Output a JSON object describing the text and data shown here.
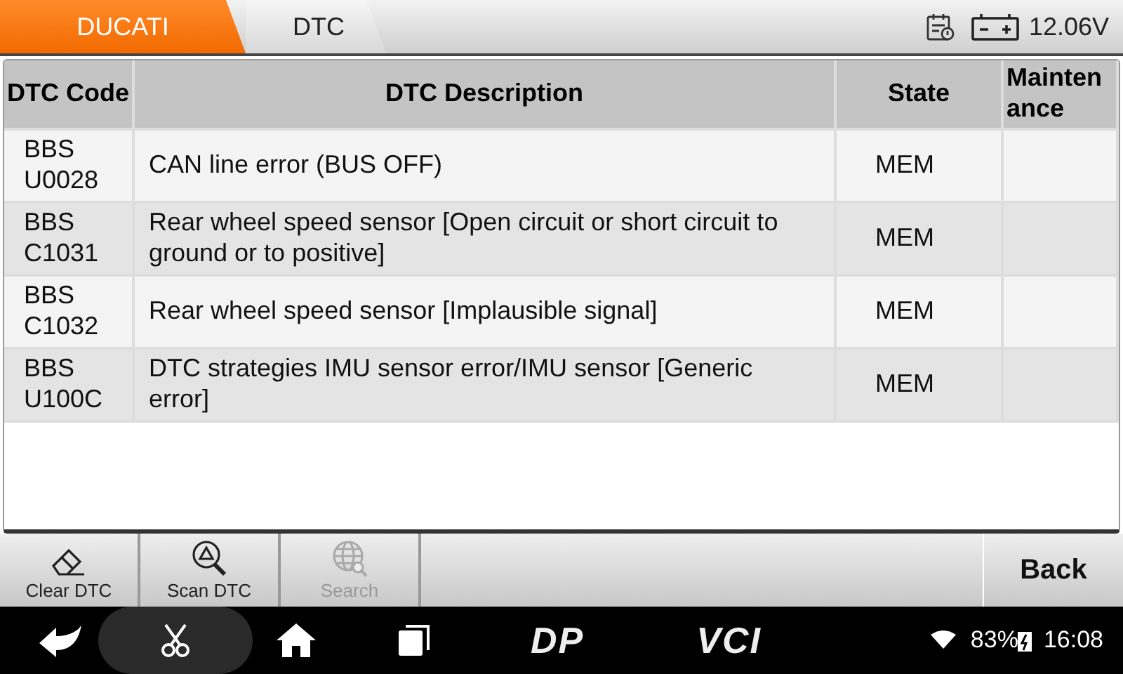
{
  "breadcrumbs": [
    {
      "label": "DUCATI",
      "selected": true
    },
    {
      "label": "DTC",
      "selected": false
    }
  ],
  "status": {
    "voltage": "12.06V"
  },
  "table": {
    "columns": [
      "DTC Code",
      "DTC Description",
      "State",
      "Mainten ance"
    ],
    "rows": [
      {
        "code": "BBS U0028",
        "description": "CAN line error (BUS OFF)",
        "state": "MEM"
      },
      {
        "code": "BBS C1031",
        "description": "Rear wheel speed sensor [Open circuit or short circuit to ground or to positive]",
        "state": "MEM"
      },
      {
        "code": "BBS C1032",
        "description": "Rear wheel speed sensor [Implausible signal]",
        "state": "MEM"
      },
      {
        "code": "BBS U100C",
        "description": "DTC strategies IMU sensor error/IMU sensor [Generic error]",
        "state": "MEM"
      }
    ]
  },
  "toolbar": [
    {
      "kind": "eraser",
      "label": "Clear DTC",
      "disabled": false
    },
    {
      "kind": "scan",
      "label": "Scan DTC",
      "disabled": false
    },
    {
      "kind": "globe",
      "label": "Search",
      "disabled": true
    }
  ],
  "back": "Back",
  "navbar": {
    "logo_1": "DP",
    "logo_2": "VCI",
    "battery": "83%",
    "time": "16:08"
  }
}
